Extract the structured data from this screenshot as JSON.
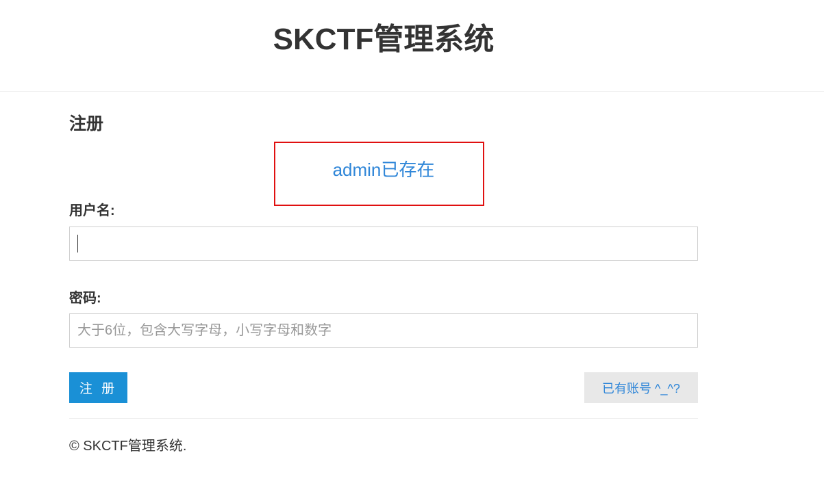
{
  "header": {
    "title": "SKCTF管理系统"
  },
  "form": {
    "section_title": "注册",
    "alert_message": "admin已存在",
    "username_label": "用户名:",
    "username_value": "",
    "password_label": "密码:",
    "password_placeholder": "大于6位，包含大写字母，小写字母和数字",
    "register_button_label": "注 册",
    "login_link_label": "已有账号 ^_^?"
  },
  "footer": {
    "copyright": "© SKCTF管理系统."
  },
  "colors": {
    "primary_button": "#1a90d6",
    "link": "#2f86d8",
    "alert_border": "#e01010",
    "secondary_button_bg": "#e8e8e8"
  }
}
